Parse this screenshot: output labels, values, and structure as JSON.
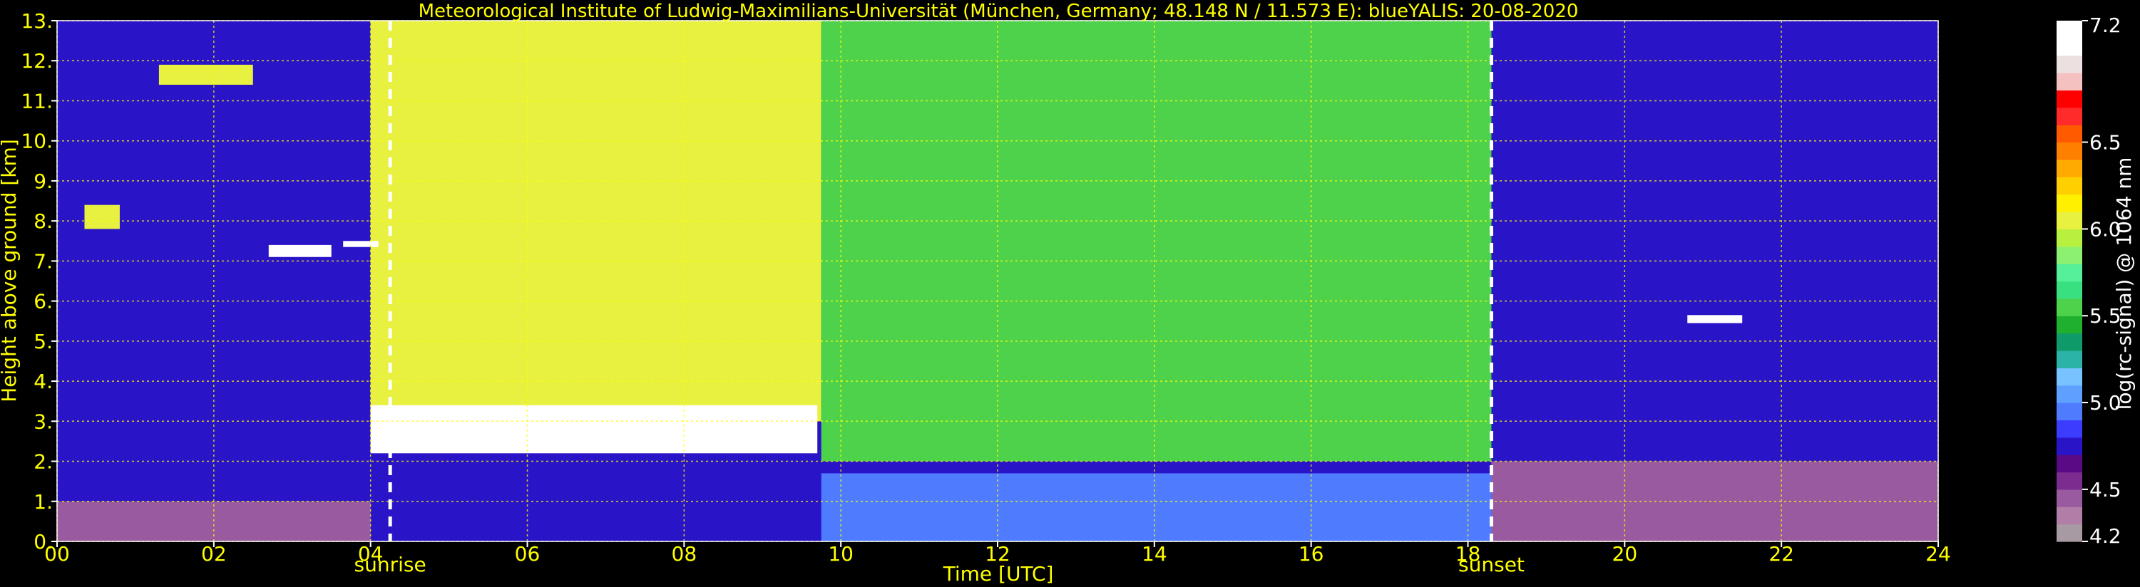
{
  "chart_data": {
    "type": "heatmap",
    "title": "Meteorological Institute of Ludwig-Maximilians-Universität (München, Germany; 48.148 N / 11.573 E):    blueYALIS: 20-08-2020",
    "xlabel": "Time [UTC]",
    "ylabel": "Height above ground [km]",
    "xlim": [
      0,
      24
    ],
    "ylim": [
      0,
      13
    ],
    "x_ticks": [
      {
        "value": 0,
        "label": "00"
      },
      {
        "value": 2,
        "label": "02"
      },
      {
        "value": 4,
        "label": "04"
      },
      {
        "value": 6,
        "label": "06"
      },
      {
        "value": 8,
        "label": "08"
      },
      {
        "value": 10,
        "label": "10"
      },
      {
        "value": 12,
        "label": "12"
      },
      {
        "value": 14,
        "label": "14"
      },
      {
        "value": 16,
        "label": "16"
      },
      {
        "value": 18,
        "label": "18"
      },
      {
        "value": 20,
        "label": "20"
      },
      {
        "value": 22,
        "label": "22"
      },
      {
        "value": 24,
        "label": "24"
      }
    ],
    "y_ticks": [
      {
        "value": 0,
        "label": "0."
      },
      {
        "value": 1,
        "label": "1."
      },
      {
        "value": 2,
        "label": "2."
      },
      {
        "value": 3,
        "label": "3."
      },
      {
        "value": 4,
        "label": "4."
      },
      {
        "value": 5,
        "label": "5."
      },
      {
        "value": 6,
        "label": "6."
      },
      {
        "value": 7,
        "label": "7."
      },
      {
        "value": 8,
        "label": "8."
      },
      {
        "value": 9,
        "label": "9."
      },
      {
        "value": 10,
        "label": "10."
      },
      {
        "value": 11,
        "label": "11."
      },
      {
        "value": 12,
        "label": "12."
      },
      {
        "value": 13,
        "label": "13."
      }
    ],
    "grid": true,
    "annotations": [
      {
        "label": "sunrise",
        "time": 4.25
      },
      {
        "label": "sunset",
        "time": 18.3
      }
    ],
    "colorbar": {
      "label": "log(rc-signal) @ 1064 nm",
      "range": [
        4.2,
        7.2
      ],
      "ticks": [
        {
          "value": 4.2,
          "label": "4.2"
        },
        {
          "value": 4.5,
          "label": "4.5"
        },
        {
          "value": 5.0,
          "label": "5.0"
        },
        {
          "value": 5.5,
          "label": "5.5"
        },
        {
          "value": 6.0,
          "label": "6.0"
        },
        {
          "value": 6.5,
          "label": "6.5"
        },
        {
          "value": 7.2,
          "label": "7.2"
        }
      ],
      "colors": [
        "#a89aa3",
        "#b07ea6",
        "#9a5aa0",
        "#7a2c8f",
        "#5a0a84",
        "#2a14c8",
        "#3c3cff",
        "#4f7cff",
        "#5fa0ff",
        "#78c2ff",
        "#2ab3a6",
        "#0f9a6a",
        "#1fb030",
        "#4ed24c",
        "#38e080",
        "#56f09a",
        "#8cf070",
        "#b8f040",
        "#e8f040",
        "#fff000",
        "#ffd000",
        "#ffaa00",
        "#ff8000",
        "#ff5a00",
        "#ff2a2a",
        "#ff0000",
        "#f4c0c0",
        "#ece0e0",
        "#ffffff",
        "#ffffff"
      ]
    },
    "layers": [
      {
        "t_start": 0.0,
        "t_end": 24.0,
        "h_bottom": 0.0,
        "h_top": 13.0,
        "level": 4.8
      },
      {
        "t_start": 4.0,
        "t_end": 9.75,
        "h_bottom": 3.0,
        "h_top": 13.0,
        "level": 6.1
      },
      {
        "t_start": 9.75,
        "t_end": 18.3,
        "h_bottom": 2.0,
        "h_top": 13.0,
        "level": 5.6
      },
      {
        "t_start": 0.0,
        "t_end": 4.0,
        "h_bottom": 0.0,
        "h_top": 1.0,
        "level": 4.4
      },
      {
        "t_start": 18.3,
        "t_end": 24.0,
        "h_bottom": 0.0,
        "h_top": 2.0,
        "level": 4.45
      },
      {
        "t_start": 9.75,
        "t_end": 18.3,
        "h_bottom": 0.0,
        "h_top": 1.7,
        "level": 4.95
      }
    ],
    "features": [
      {
        "t_start": 1.3,
        "t_end": 2.5,
        "h_bottom": 11.4,
        "h_top": 11.9,
        "level": 6.0
      },
      {
        "t_start": 0.35,
        "t_end": 0.8,
        "h_bottom": 7.8,
        "h_top": 8.4,
        "level": 6.1
      },
      {
        "t_start": 2.7,
        "t_end": 3.5,
        "h_bottom": 7.1,
        "h_top": 7.4,
        "level": 7.2
      },
      {
        "t_start": 3.65,
        "t_end": 4.1,
        "h_bottom": 7.35,
        "h_top": 7.5,
        "level": 7.2
      },
      {
        "t_start": 4.0,
        "t_end": 9.7,
        "h_bottom": 2.2,
        "h_top": 3.4,
        "level": 7.2
      },
      {
        "t_start": 20.8,
        "t_end": 21.5,
        "h_bottom": 5.45,
        "h_top": 5.65,
        "level": 7.2
      }
    ]
  }
}
